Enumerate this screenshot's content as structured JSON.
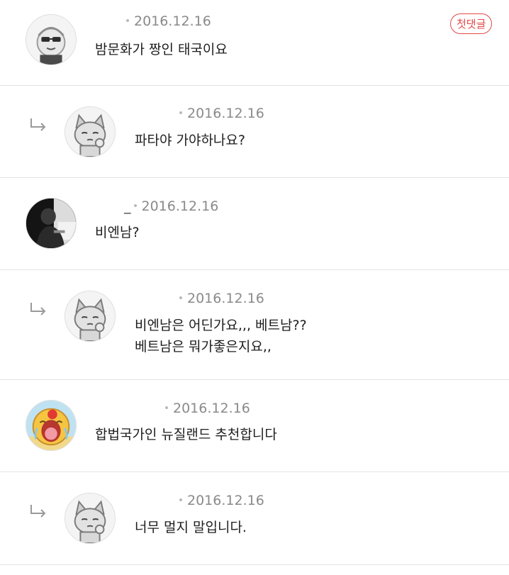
{
  "first_comment_badge": "첫댓글",
  "comments": [
    {
      "nickname": "",
      "date": "2016.12.16",
      "lines": [
        "밤문화가 짱인 태국이요"
      ],
      "avatar": "sunglasses-character-avatar",
      "is_reply": false
    },
    {
      "nickname": "",
      "date": "2016.12.16",
      "lines": [
        "파타야 가야하나요?"
      ],
      "avatar": "gray-cat-character-avatar",
      "is_reply": true
    },
    {
      "nickname": "_",
      "date": "2016.12.16",
      "lines": [
        "비엔남?"
      ],
      "avatar": "dark-photo-avatar",
      "is_reply": false
    },
    {
      "nickname": "",
      "date": "2016.12.16",
      "lines": [
        "비엔남은 어딘가요,,, 베트남??",
        "베트남은 뭐가좋은지요,,"
      ],
      "avatar": "gray-cat-character-avatar",
      "is_reply": true
    },
    {
      "nickname": "",
      "date": "2016.12.16",
      "lines": [
        "합법국가인 뉴질랜드 추천합니다"
      ],
      "avatar": "crying-character-avatar",
      "is_reply": false
    },
    {
      "nickname": "",
      "date": "2016.12.16",
      "lines": [
        "너무 멀지 말입니다."
      ],
      "avatar": "gray-cat-character-avatar",
      "is_reply": true
    }
  ],
  "colors": {
    "badge": "#e54848",
    "date": "#8a8a8a",
    "divider": "#e4e4e4",
    "reply_arrow": "#9a9a9a"
  },
  "icons": {
    "reply": "reply-arrow-icon"
  }
}
